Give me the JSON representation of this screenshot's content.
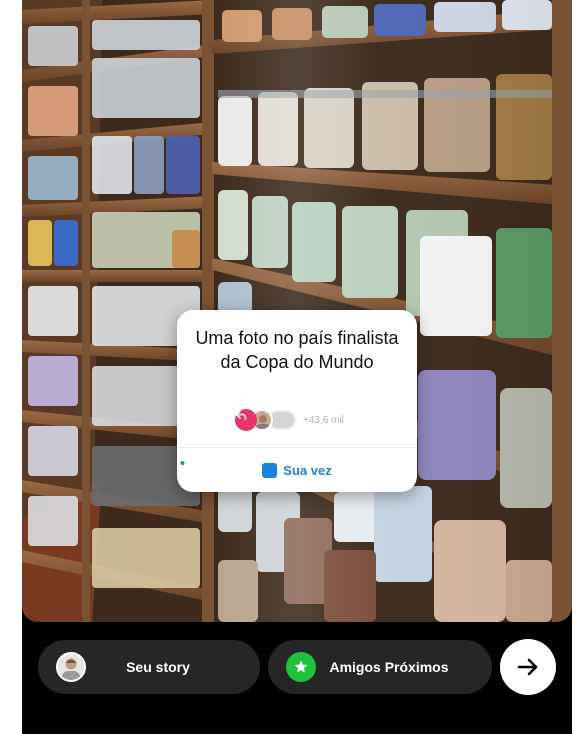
{
  "sticker": {
    "question": "Uma foto no país finalista da Copa do Mundo",
    "response_count": "+43,6 mil",
    "action_label": "Sua vez"
  },
  "bottom_bar": {
    "your_story_label": "Seu story",
    "close_friends_label": "Amigos Próximos"
  },
  "icons": {
    "reply": "reply-arrow-icon",
    "camera": "camera-icon",
    "star": "star-icon",
    "next": "arrow-right-icon"
  },
  "colors": {
    "reply_badge": "#e8336d",
    "action_blue": "#1a85d6",
    "close_friends_green": "#1fc23b",
    "pill_bg": "#262626"
  }
}
